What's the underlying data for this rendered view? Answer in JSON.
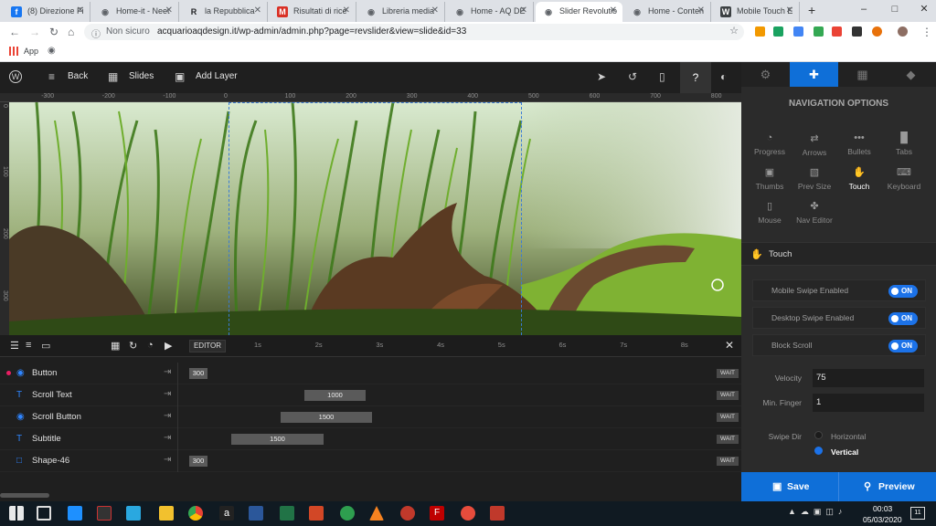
{
  "browser": {
    "tabs": [
      {
        "title": "(8) Direzione Fi",
        "fav": "f",
        "color": "#1877f2"
      },
      {
        "title": "Home-it - Neet",
        "fav": "globe",
        "color": "#5f6368"
      },
      {
        "title": "la Repubblica",
        "fav": "R",
        "color": "#202124"
      },
      {
        "title": "Risultati di rice",
        "fav": "M",
        "color": "#d93025"
      },
      {
        "title": "Libreria media",
        "fav": "globe",
        "color": "#5f6368"
      },
      {
        "title": "Home - AQ DE",
        "fav": "globe",
        "color": "#5f6368"
      },
      {
        "title": "Slider Revolutio",
        "fav": "globe",
        "color": "#5f6368",
        "active": true
      },
      {
        "title": "Home - Conten",
        "fav": "globe",
        "color": "#5f6368"
      },
      {
        "title": "Mobile Touch E",
        "fav": "W",
        "color": "#3c4043"
      }
    ],
    "security": "Non sicuro",
    "url": "acquarioaqdesign.it/wp-admin/admin.php?page=revslider&view=slide&id=33",
    "bookmarks_label": "App"
  },
  "editor": {
    "back_label": "Back",
    "slides_label": "Slides",
    "add_layer_label": "Add Layer",
    "ruler_ticks": [
      "-300",
      "-200",
      "-100",
      "0",
      "100",
      "200",
      "300",
      "400",
      "500",
      "600",
      "700",
      "800"
    ],
    "vruler_ticks": [
      "0",
      "100",
      "200",
      "300"
    ],
    "editor_label": "EDITOR",
    "time_ticks": [
      "1s",
      "2s",
      "3s",
      "4s",
      "5s",
      "6s",
      "7s",
      "8s"
    ]
  },
  "layers": [
    {
      "name": "Button",
      "icon": "target-icon",
      "start_label": "300",
      "bar": "",
      "wait": "WAIT"
    },
    {
      "name": "Scroll Text",
      "icon": "text-icon",
      "start_label": "",
      "bar": "1000",
      "wait": "WAIT"
    },
    {
      "name": "Scroll Button",
      "icon": "target-icon",
      "start_label": "",
      "bar": "1500",
      "wait": "WAIT"
    },
    {
      "name": "Subtitle",
      "icon": "text-icon",
      "start_label": "",
      "bar": "1500",
      "wait": "WAIT"
    },
    {
      "name": "Shape-46",
      "icon": "square-icon",
      "start_label": "300",
      "bar": "",
      "wait": "WAIT"
    }
  ],
  "panel": {
    "title": "NAVIGATION OPTIONS",
    "options": [
      {
        "label": "Progress",
        "icon": "progress-icon"
      },
      {
        "label": "Arrows",
        "icon": "arrows-icon"
      },
      {
        "label": "Bullets",
        "icon": "bullets-icon"
      },
      {
        "label": "Tabs",
        "icon": "tabs-icon"
      },
      {
        "label": "Thumbs",
        "icon": "thumbs-icon"
      },
      {
        "label": "Prev Size",
        "icon": "image-icon"
      },
      {
        "label": "Touch",
        "icon": "hand-icon",
        "selected": true
      },
      {
        "label": "Keyboard",
        "icon": "keyboard-icon"
      },
      {
        "label": "Mouse",
        "icon": "mouse-icon"
      },
      {
        "label": "Nav Editor",
        "icon": "nav-editor-icon"
      }
    ],
    "section_title": "Touch",
    "toggles": [
      {
        "label": "Mobile Swipe Enabled",
        "value": "ON"
      },
      {
        "label": "Desktop Swipe Enabled",
        "value": "ON"
      },
      {
        "label": "Block Scroll",
        "value": "ON"
      }
    ],
    "velocity_label": "Velocity",
    "velocity_value": "75",
    "min_finger_label": "Min. Finger",
    "min_finger_value": "1",
    "swipe_dir_label": "Swipe Dir",
    "swipe_options": [
      "Horizontal",
      "Vertical"
    ],
    "swipe_selected": "Vertical",
    "save_label": "Save",
    "preview_label": "Preview"
  },
  "taskbar": {
    "time": "00:03",
    "date": "05/03/2020",
    "notifications": "11"
  },
  "colors": {
    "accent": "#0f6fd8",
    "toggle": "#1c72e8",
    "layer_icon": "#2f85ff"
  }
}
